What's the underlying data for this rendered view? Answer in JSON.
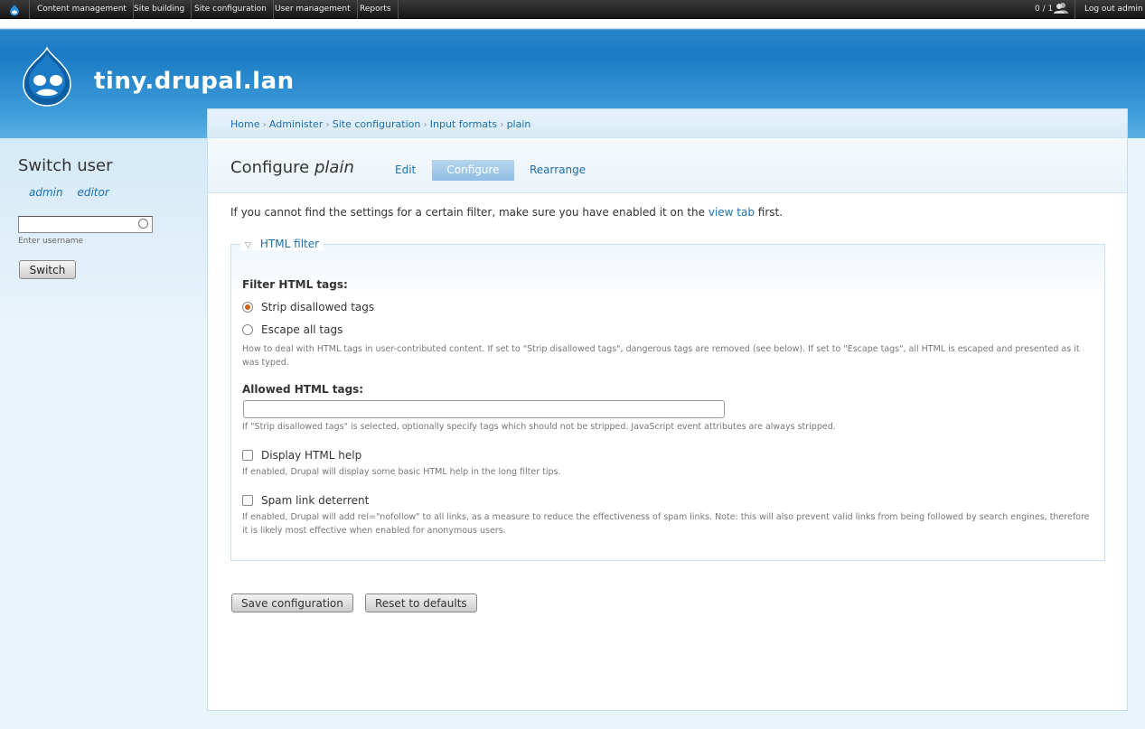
{
  "toolbar": {
    "menu": [
      "Content management",
      "Site building",
      "Site configuration",
      "User management",
      "Reports"
    ],
    "user_count": "0 / 1",
    "logout": "Log out admin"
  },
  "header": {
    "site_name": "tiny.drupal.lan"
  },
  "sidebar": {
    "title": "Switch user",
    "users": [
      "admin",
      "editor"
    ],
    "input_value": "",
    "input_hint": "Enter username",
    "switch_button": "Switch"
  },
  "breadcrumb": [
    "Home",
    "Administer",
    "Site configuration",
    "Input formats",
    "plain"
  ],
  "page": {
    "title_prefix": "Configure",
    "title_name": "plain",
    "tabs": [
      {
        "label": "Edit",
        "active": false
      },
      {
        "label": "Configure",
        "active": true
      },
      {
        "label": "Rearrange",
        "active": false
      }
    ],
    "intro_before": "If you cannot find the settings for a certain filter, make sure you have enabled it on the",
    "intro_link": "view tab",
    "intro_after": "first."
  },
  "fieldset": {
    "legend": "HTML filter",
    "filter_tags_label": "Filter HTML tags:",
    "options": [
      {
        "label": "Strip disallowed tags",
        "checked": true
      },
      {
        "label": "Escape all tags",
        "checked": false
      }
    ],
    "filter_tags_desc": "How to deal with HTML tags in user-contributed content. If set to \"Strip disallowed tags\", dangerous tags are removed (see below). If set to \"Escape tags\", all HTML is escaped and presented as it was typed.",
    "allowed_label": "Allowed HTML tags:",
    "allowed_value": "",
    "allowed_desc": "If \"Strip disallowed tags\" is selected, optionally specify tags which should not be stripped. JavaScript event attributes are always stripped.",
    "html_help_label": "Display HTML help",
    "html_help_checked": false,
    "html_help_desc": "If enabled, Drupal will display some basic HTML help in the long filter tips.",
    "spam_label": "Spam link deterrent",
    "spam_checked": false,
    "spam_desc": "If enabled, Drupal will add rel=\"nofollow\" to all links, as a measure to reduce the effectiveness of spam links. Note: this will also prevent valid links from being followed by search engines, therefore it is likely most effective when enabled for anonymous users."
  },
  "buttons": {
    "save": "Save configuration",
    "reset": "Reset to defaults"
  },
  "colors": {
    "link": "#1b6fae",
    "header_blue": "#1a7bc4",
    "radio_accent": "#d0601e"
  }
}
